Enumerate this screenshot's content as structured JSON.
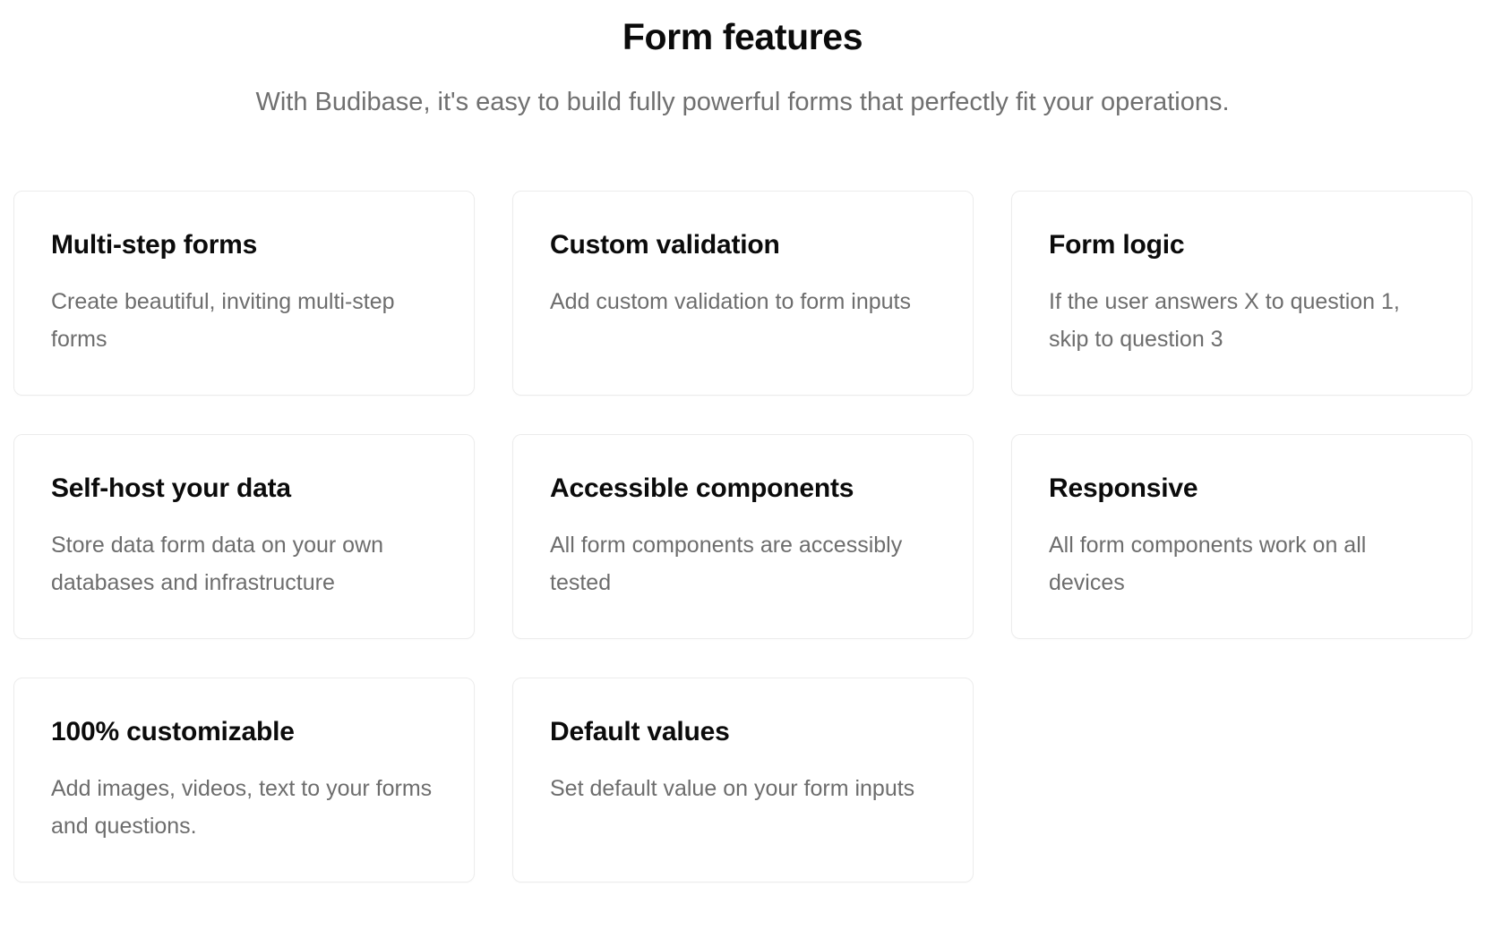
{
  "header": {
    "title": "Form features",
    "subtitle": "With Budibase, it's easy to build fully powerful forms that perfectly fit your operations."
  },
  "features": [
    {
      "title": "Multi-step forms",
      "description": "Create beautiful, inviting multi-step forms"
    },
    {
      "title": "Custom validation",
      "description": "Add custom validation to form inputs"
    },
    {
      "title": "Form logic",
      "description": "If the user answers X to question 1, skip to question 3"
    },
    {
      "title": "Self-host your data",
      "description": "Store data form data on your own databases and infrastructure"
    },
    {
      "title": "Accessible components",
      "description": "All form components are accessibly tested"
    },
    {
      "title": "Responsive",
      "description": "All form components work on all devices"
    },
    {
      "title": "100% customizable",
      "description": "Add images, videos, text to your forms and questions."
    },
    {
      "title": "Default values",
      "description": "Set default value on your form inputs"
    }
  ]
}
